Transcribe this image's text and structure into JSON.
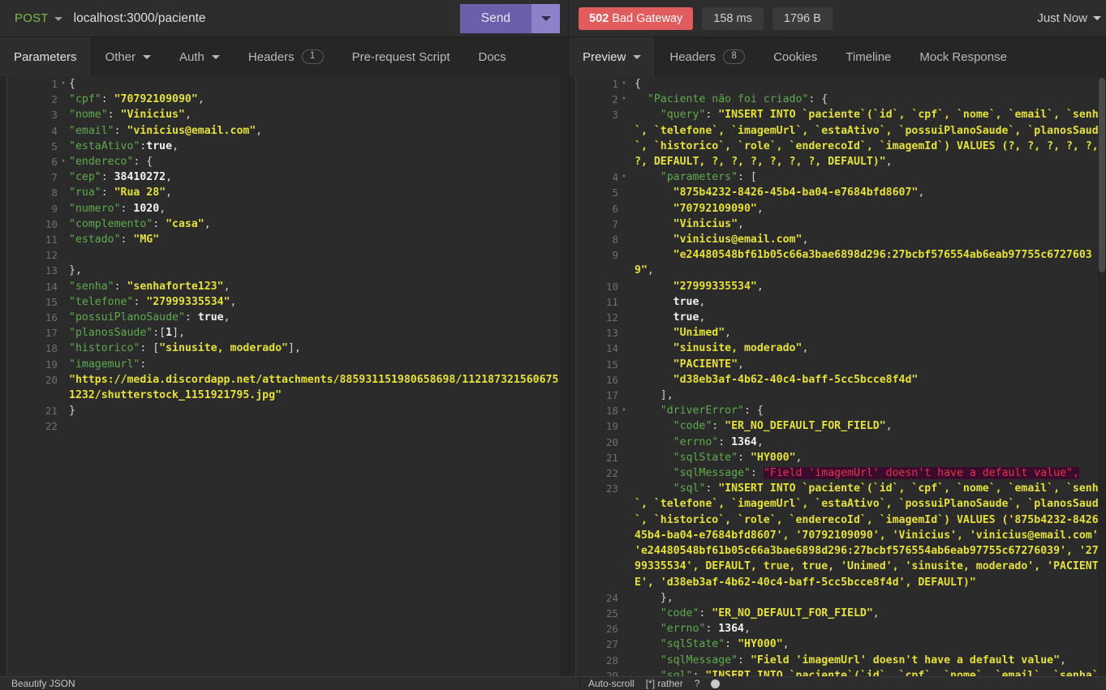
{
  "request": {
    "method": "POST",
    "url": "localhost:3000/paciente",
    "send_label": "Send"
  },
  "response_status": {
    "code": "502",
    "text": "Bad Gateway",
    "time": "158 ms",
    "size": "1796 B",
    "when": "Just Now"
  },
  "request_tabs": [
    {
      "label": "Parameters",
      "active": true,
      "caret": false,
      "badge": null
    },
    {
      "label": "Other",
      "active": false,
      "caret": true,
      "badge": null
    },
    {
      "label": "Auth",
      "active": false,
      "caret": true,
      "badge": null
    },
    {
      "label": "Headers",
      "active": false,
      "caret": false,
      "badge": "1"
    },
    {
      "label": "Pre-request Script",
      "active": false,
      "caret": false,
      "badge": null
    },
    {
      "label": "Docs",
      "active": false,
      "caret": false,
      "badge": null
    }
  ],
  "response_tabs": [
    {
      "label": "Preview",
      "active": true,
      "caret": true,
      "badge": null
    },
    {
      "label": "Headers",
      "active": false,
      "caret": false,
      "badge": "8"
    },
    {
      "label": "Cookies",
      "active": false,
      "caret": false,
      "badge": null
    },
    {
      "label": "Timeline",
      "active": false,
      "caret": false,
      "badge": null
    },
    {
      "label": "Mock Response",
      "active": false,
      "caret": false,
      "badge": null
    }
  ],
  "request_body_lines": [
    {
      "n": "1",
      "fold": true,
      "tokens": [
        {
          "t": "p",
          "v": "{"
        }
      ]
    },
    {
      "n": "2",
      "fold": false,
      "tokens": [
        {
          "t": "k",
          "v": "\"cpf\""
        },
        {
          "t": "p",
          "v": ": "
        },
        {
          "t": "s",
          "v": "\"70792109090\""
        },
        {
          "t": "p",
          "v": ","
        }
      ]
    },
    {
      "n": "3",
      "fold": false,
      "tokens": [
        {
          "t": "k",
          "v": "\"nome\""
        },
        {
          "t": "p",
          "v": ": "
        },
        {
          "t": "s",
          "v": "\"Vinicius\""
        },
        {
          "t": "p",
          "v": ","
        }
      ]
    },
    {
      "n": "4",
      "fold": false,
      "tokens": [
        {
          "t": "k",
          "v": "\"email\""
        },
        {
          "t": "p",
          "v": ": "
        },
        {
          "t": "s",
          "v": "\"vinicius@email.com\""
        },
        {
          "t": "p",
          "v": ","
        }
      ]
    },
    {
      "n": "5",
      "fold": false,
      "tokens": [
        {
          "t": "k",
          "v": "\"estaAtivo\""
        },
        {
          "t": "p",
          "v": ":"
        },
        {
          "t": "n",
          "v": "true"
        },
        {
          "t": "p",
          "v": ","
        }
      ]
    },
    {
      "n": "6",
      "fold": true,
      "tokens": [
        {
          "t": "k",
          "v": "\"endereco\""
        },
        {
          "t": "p",
          "v": ": {"
        }
      ]
    },
    {
      "n": "7",
      "fold": false,
      "tokens": [
        {
          "t": "k",
          "v": "\"cep\""
        },
        {
          "t": "p",
          "v": ": "
        },
        {
          "t": "n",
          "v": "38410272"
        },
        {
          "t": "p",
          "v": ","
        }
      ]
    },
    {
      "n": "8",
      "fold": false,
      "tokens": [
        {
          "t": "k",
          "v": "\"rua\""
        },
        {
          "t": "p",
          "v": ": "
        },
        {
          "t": "s",
          "v": "\"Rua 28\""
        },
        {
          "t": "p",
          "v": ","
        }
      ]
    },
    {
      "n": "9",
      "fold": false,
      "tokens": [
        {
          "t": "k",
          "v": "\"numero\""
        },
        {
          "t": "p",
          "v": ": "
        },
        {
          "t": "n",
          "v": "1020"
        },
        {
          "t": "p",
          "v": ","
        }
      ]
    },
    {
      "n": "10",
      "fold": false,
      "tokens": [
        {
          "t": "k",
          "v": "\"complemento\""
        },
        {
          "t": "p",
          "v": ": "
        },
        {
          "t": "s",
          "v": "\"casa\""
        },
        {
          "t": "p",
          "v": ","
        }
      ]
    },
    {
      "n": "11",
      "fold": false,
      "tokens": [
        {
          "t": "k",
          "v": "\"estado\""
        },
        {
          "t": "p",
          "v": ": "
        },
        {
          "t": "s",
          "v": "\"MG\""
        }
      ]
    },
    {
      "n": "12",
      "fold": false,
      "tokens": [
        {
          "t": "p",
          "v": ""
        }
      ]
    },
    {
      "n": "13",
      "fold": false,
      "tokens": [
        {
          "t": "p",
          "v": "},"
        }
      ]
    },
    {
      "n": "14",
      "fold": false,
      "tokens": [
        {
          "t": "k",
          "v": "\"senha\""
        },
        {
          "t": "p",
          "v": ": "
        },
        {
          "t": "s",
          "v": "\"senhaforte123\""
        },
        {
          "t": "p",
          "v": ","
        }
      ]
    },
    {
      "n": "15",
      "fold": false,
      "tokens": [
        {
          "t": "k",
          "v": "\"telefone\""
        },
        {
          "t": "p",
          "v": ": "
        },
        {
          "t": "s",
          "v": "\"27999335534\""
        },
        {
          "t": "p",
          "v": ","
        }
      ]
    },
    {
      "n": "16",
      "fold": false,
      "tokens": [
        {
          "t": "k",
          "v": "\"possuiPlanoSaude\""
        },
        {
          "t": "p",
          "v": ": "
        },
        {
          "t": "n",
          "v": "true"
        },
        {
          "t": "p",
          "v": ","
        }
      ]
    },
    {
      "n": "17",
      "fold": false,
      "tokens": [
        {
          "t": "k",
          "v": "\"planosSaude\""
        },
        {
          "t": "p",
          "v": ":["
        },
        {
          "t": "n",
          "v": "1"
        },
        {
          "t": "p",
          "v": "],"
        }
      ]
    },
    {
      "n": "18",
      "fold": false,
      "tokens": [
        {
          "t": "k",
          "v": "\"historico\""
        },
        {
          "t": "p",
          "v": ": ["
        },
        {
          "t": "s",
          "v": "\"sinusite, moderado\""
        },
        {
          "t": "p",
          "v": "],"
        }
      ]
    },
    {
      "n": "19",
      "fold": false,
      "tokens": [
        {
          "t": "k",
          "v": "\"imagemurl\""
        },
        {
          "t": "p",
          "v": ":"
        }
      ]
    },
    {
      "n": "20",
      "fold": false,
      "tokens": [
        {
          "t": "s",
          "v": "\"https://media.discordapp.net/attachments/885931151980658698/1121873215606751232/shutterstock_1151921795.jpg\""
        }
      ]
    },
    {
      "n": "21",
      "fold": false,
      "tokens": [
        {
          "t": "p",
          "v": "}"
        }
      ]
    },
    {
      "n": "22",
      "fold": false,
      "tokens": [
        {
          "t": "p",
          "v": ""
        }
      ]
    }
  ],
  "response_body_lines": [
    {
      "n": "1",
      "fold": true,
      "tokens": [
        {
          "t": "p",
          "v": "{"
        }
      ]
    },
    {
      "n": "2",
      "fold": true,
      "tokens": [
        {
          "t": "p",
          "v": "  "
        },
        {
          "t": "k",
          "v": "\"Paciente não foi criado\""
        },
        {
          "t": "p",
          "v": ": {"
        }
      ]
    },
    {
      "n": "3",
      "fold": false,
      "tokens": [
        {
          "t": "p",
          "v": "    "
        },
        {
          "t": "k",
          "v": "\"query\""
        },
        {
          "t": "p",
          "v": ": "
        },
        {
          "t": "s",
          "v": "\"INSERT INTO `paciente`(`id`, `cpf`, `nome`, `email`, `senha`, `telefone`, `imagemUrl`, `estaAtivo`, `possuiPlanoSaude`, `planosSaude`, `historico`, `role`, `enderecoId`, `imagemId`) VALUES (?, ?, ?, ?, ?, ?, DEFAULT, ?, ?, ?, ?, ?, ?, DEFAULT)\""
        },
        {
          "t": "p",
          "v": ","
        }
      ]
    },
    {
      "n": "4",
      "fold": true,
      "tokens": [
        {
          "t": "p",
          "v": "    "
        },
        {
          "t": "k",
          "v": "\"parameters\""
        },
        {
          "t": "p",
          "v": ": ["
        }
      ]
    },
    {
      "n": "5",
      "fold": false,
      "tokens": [
        {
          "t": "p",
          "v": "      "
        },
        {
          "t": "s",
          "v": "\"875b4232-8426-45b4-ba04-e7684bfd8607\""
        },
        {
          "t": "p",
          "v": ","
        }
      ]
    },
    {
      "n": "6",
      "fold": false,
      "tokens": [
        {
          "t": "p",
          "v": "      "
        },
        {
          "t": "s",
          "v": "\"70792109090\""
        },
        {
          "t": "p",
          "v": ","
        }
      ]
    },
    {
      "n": "7",
      "fold": false,
      "tokens": [
        {
          "t": "p",
          "v": "      "
        },
        {
          "t": "s",
          "v": "\"Vinicius\""
        },
        {
          "t": "p",
          "v": ","
        }
      ]
    },
    {
      "n": "8",
      "fold": false,
      "tokens": [
        {
          "t": "p",
          "v": "      "
        },
        {
          "t": "s",
          "v": "\"vinicius@email.com\""
        },
        {
          "t": "p",
          "v": ","
        }
      ]
    },
    {
      "n": "9",
      "fold": false,
      "tokens": [
        {
          "t": "p",
          "v": "      "
        },
        {
          "t": "s",
          "v": "\"e24480548bf61b05c66a3bae6898d296:27bcbf576554ab6eab97755c67276039\""
        },
        {
          "t": "p",
          "v": ","
        }
      ]
    },
    {
      "n": "10",
      "fold": false,
      "tokens": [
        {
          "t": "p",
          "v": "      "
        },
        {
          "t": "s",
          "v": "\"27999335534\""
        },
        {
          "t": "p",
          "v": ","
        }
      ]
    },
    {
      "n": "11",
      "fold": false,
      "tokens": [
        {
          "t": "p",
          "v": "      "
        },
        {
          "t": "n",
          "v": "true"
        },
        {
          "t": "p",
          "v": ","
        }
      ]
    },
    {
      "n": "12",
      "fold": false,
      "tokens": [
        {
          "t": "p",
          "v": "      "
        },
        {
          "t": "n",
          "v": "true"
        },
        {
          "t": "p",
          "v": ","
        }
      ]
    },
    {
      "n": "13",
      "fold": false,
      "tokens": [
        {
          "t": "p",
          "v": "      "
        },
        {
          "t": "s",
          "v": "\"Unimed\""
        },
        {
          "t": "p",
          "v": ","
        }
      ]
    },
    {
      "n": "14",
      "fold": false,
      "tokens": [
        {
          "t": "p",
          "v": "      "
        },
        {
          "t": "s",
          "v": "\"sinusite, moderado\""
        },
        {
          "t": "p",
          "v": ","
        }
      ]
    },
    {
      "n": "15",
      "fold": false,
      "tokens": [
        {
          "t": "p",
          "v": "      "
        },
        {
          "t": "s",
          "v": "\"PACIENTE\""
        },
        {
          "t": "p",
          "v": ","
        }
      ]
    },
    {
      "n": "16",
      "fold": false,
      "tokens": [
        {
          "t": "p",
          "v": "      "
        },
        {
          "t": "s",
          "v": "\"d38eb3af-4b62-40c4-baff-5cc5bcce8f4d\""
        }
      ]
    },
    {
      "n": "17",
      "fold": false,
      "tokens": [
        {
          "t": "p",
          "v": "    ],"
        }
      ]
    },
    {
      "n": "18",
      "fold": true,
      "tokens": [
        {
          "t": "p",
          "v": "    "
        },
        {
          "t": "k",
          "v": "\"driverError\""
        },
        {
          "t": "p",
          "v": ": {"
        }
      ]
    },
    {
      "n": "19",
      "fold": false,
      "tokens": [
        {
          "t": "p",
          "v": "      "
        },
        {
          "t": "k",
          "v": "\"code\""
        },
        {
          "t": "p",
          "v": ": "
        },
        {
          "t": "s",
          "v": "\"ER_NO_DEFAULT_FOR_FIELD\""
        },
        {
          "t": "p",
          "v": ","
        }
      ]
    },
    {
      "n": "20",
      "fold": false,
      "tokens": [
        {
          "t": "p",
          "v": "      "
        },
        {
          "t": "k",
          "v": "\"errno\""
        },
        {
          "t": "p",
          "v": ": "
        },
        {
          "t": "n",
          "v": "1364"
        },
        {
          "t": "p",
          "v": ","
        }
      ]
    },
    {
      "n": "21",
      "fold": false,
      "tokens": [
        {
          "t": "p",
          "v": "      "
        },
        {
          "t": "k",
          "v": "\"sqlState\""
        },
        {
          "t": "p",
          "v": ": "
        },
        {
          "t": "s",
          "v": "\"HY000\""
        },
        {
          "t": "p",
          "v": ","
        }
      ]
    },
    {
      "n": "22",
      "fold": false,
      "tokens": [
        {
          "t": "p",
          "v": "      "
        },
        {
          "t": "k",
          "v": "\"sqlMessage\""
        },
        {
          "t": "p",
          "v": ": "
        },
        {
          "t": "hl",
          "v": "\"Field 'imagemUrl' doesn't have a default value\","
        }
      ]
    },
    {
      "n": "23",
      "fold": false,
      "tokens": [
        {
          "t": "p",
          "v": "      "
        },
        {
          "t": "k",
          "v": "\"sql\""
        },
        {
          "t": "p",
          "v": ": "
        },
        {
          "t": "s",
          "v": "\"INSERT INTO `paciente`(`id`, `cpf`, `nome`, `email`, `senha`, `telefone`, `imagemUrl`, `estaAtivo`, `possuiPlanoSaude`, `planosSaude`, `historico`, `role`, `enderecoId`, `imagemId`) VALUES ('875b4232-8426-45b4-ba04-e7684bfd8607', '70792109090', 'Vinicius', 'vinicius@email.com', 'e24480548bf61b05c66a3bae6898d296:27bcbf576554ab6eab97755c67276039', '27999335534', DEFAULT, true, true, 'Unimed', 'sinusite, moderado', 'PACIENTE', 'd38eb3af-4b62-40c4-baff-5cc5bcce8f4d', DEFAULT)\""
        }
      ]
    },
    {
      "n": "24",
      "fold": false,
      "tokens": [
        {
          "t": "p",
          "v": "    },"
        }
      ]
    },
    {
      "n": "25",
      "fold": false,
      "tokens": [
        {
          "t": "p",
          "v": "    "
        },
        {
          "t": "k",
          "v": "\"code\""
        },
        {
          "t": "p",
          "v": ": "
        },
        {
          "t": "s",
          "v": "\"ER_NO_DEFAULT_FOR_FIELD\""
        },
        {
          "t": "p",
          "v": ","
        }
      ]
    },
    {
      "n": "26",
      "fold": false,
      "tokens": [
        {
          "t": "p",
          "v": "    "
        },
        {
          "t": "k",
          "v": "\"errno\""
        },
        {
          "t": "p",
          "v": ": "
        },
        {
          "t": "n",
          "v": "1364"
        },
        {
          "t": "p",
          "v": ","
        }
      ]
    },
    {
      "n": "27",
      "fold": false,
      "tokens": [
        {
          "t": "p",
          "v": "    "
        },
        {
          "t": "k",
          "v": "\"sqlState\""
        },
        {
          "t": "p",
          "v": ": "
        },
        {
          "t": "s",
          "v": "\"HY000\""
        },
        {
          "t": "p",
          "v": ","
        }
      ]
    },
    {
      "n": "28",
      "fold": false,
      "tokens": [
        {
          "t": "p",
          "v": "    "
        },
        {
          "t": "k",
          "v": "\"sqlMessage\""
        },
        {
          "t": "p",
          "v": ": "
        },
        {
          "t": "s",
          "v": "\"Field 'imagemUrl' doesn't have a default value\""
        },
        {
          "t": "p",
          "v": ","
        }
      ]
    },
    {
      "n": "29",
      "fold": false,
      "tokens": [
        {
          "t": "p",
          "v": "    "
        },
        {
          "t": "k",
          "v": "\"sql\""
        },
        {
          "t": "p",
          "v": ": "
        },
        {
          "t": "s",
          "v": "\"INSERT INTO `paciente`(`id`, `cpf`, `nome`, `email`, `senha`,"
        }
      ]
    }
  ],
  "statusbar": {
    "left_label": "Beautify JSON",
    "right_items": [
      "Auto-scroll",
      "[*] rather",
      "?"
    ]
  },
  "colors": {
    "accent_purple": "#6b5eaa",
    "error_red": "#e15c5c",
    "key_green": "#5fab4e",
    "string_yellow": "#e5e03a",
    "highlight_bg": "#3c0a2c",
    "highlight_fg": "#e0344e"
  }
}
